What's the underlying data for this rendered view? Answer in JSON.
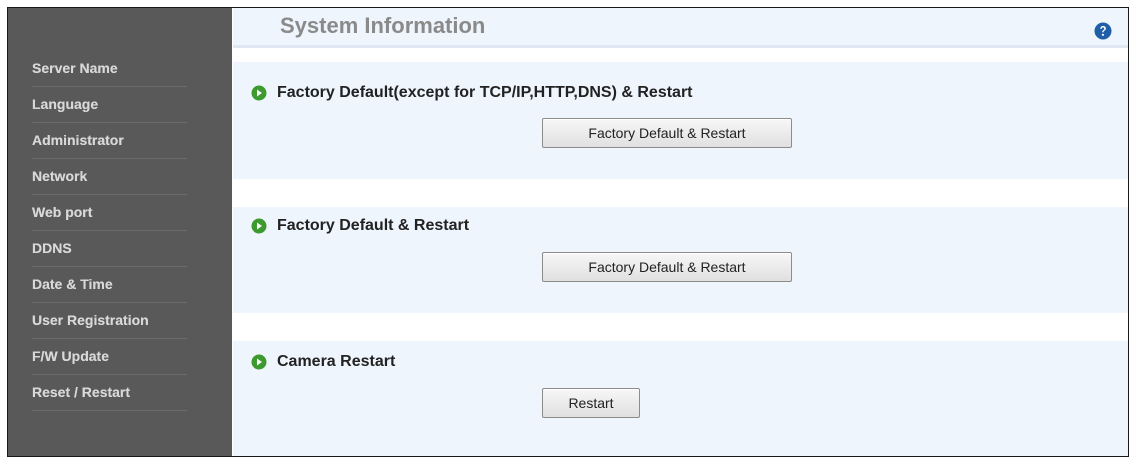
{
  "sidebar": {
    "items": [
      {
        "label": "Server Name"
      },
      {
        "label": "Language"
      },
      {
        "label": "Administrator"
      },
      {
        "label": "Network"
      },
      {
        "label": "Web port"
      },
      {
        "label": "DDNS"
      },
      {
        "label": "Date & Time"
      },
      {
        "label": "User Registration"
      },
      {
        "label": "F/W Update"
      },
      {
        "label": "Reset / Restart"
      }
    ]
  },
  "header": {
    "title": "System Information",
    "help_icon": "question-circle-icon"
  },
  "sections": [
    {
      "title": "Factory Default(except for TCP/IP,HTTP,DNS) & Restart",
      "button_label": "Factory Default & Restart"
    },
    {
      "title": "Factory Default & Restart",
      "button_label": "Factory Default & Restart"
    },
    {
      "title": "Camera Restart",
      "button_label": "Restart"
    }
  ],
  "colors": {
    "sidebar_bg": "#595959",
    "sidebar_text": "#d8d8d8",
    "panel_bg": "#eef5fc",
    "bullet_green": "#3c9a2e",
    "help_blue": "#1f5fa8"
  }
}
